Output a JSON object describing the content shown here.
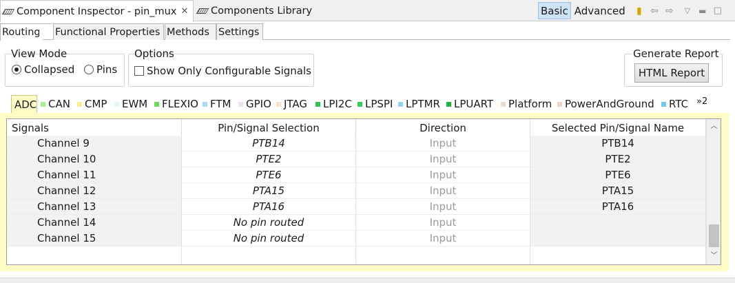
{
  "window": {
    "active_tab": "Component Inspector - pin_mux",
    "other_tab": "Components Library",
    "mode_basic": "Basic",
    "mode_advanced": "Advanced",
    "icons": [
      "note-icon",
      "back-arrow-icon",
      "forward-arrow-icon",
      "view-menu-icon",
      "minimize-icon",
      "maximize-icon"
    ]
  },
  "page_tabs": [
    "Routing",
    "Functional Properties",
    "Methods",
    "Settings"
  ],
  "view_mode": {
    "title": "View Mode",
    "options": [
      "Collapsed",
      "Pins"
    ],
    "selected": "Collapsed"
  },
  "options_group": {
    "title": "Options",
    "checkbox_label": "Show Only Configurable Signals",
    "checked": false
  },
  "report": {
    "title": "Generate Report",
    "button": "HTML Report"
  },
  "peripherals": {
    "tabs": [
      {
        "label": "ADC",
        "color": "#f3f08a"
      },
      {
        "label": "CAN",
        "color": "#a6ee8f"
      },
      {
        "label": "CMP",
        "color": "#f4f08a"
      },
      {
        "label": "EWM",
        "color": "#e3f4fb"
      },
      {
        "label": "FLEXIO",
        "color": "#6edc5a"
      },
      {
        "label": "FTM",
        "color": "#a9dcf4"
      },
      {
        "label": "GPIO",
        "color": "#f0dff4"
      },
      {
        "label": "JTAG",
        "color": "#f8e2cf"
      },
      {
        "label": "LPI2C",
        "color": "#33c24a"
      },
      {
        "label": "LPSPI",
        "color": "#30d152"
      },
      {
        "label": "LPTMR",
        "color": "#8fd5f3"
      },
      {
        "label": "LPUART",
        "color": "#1bb53a"
      },
      {
        "label": "Platform",
        "color": "#efd8cc"
      },
      {
        "label": "PowerAndGround",
        "color": "#e6d7cd"
      },
      {
        "label": "RTC",
        "color": "#6fc8ef"
      }
    ],
    "active": "ADC",
    "more_label": "»2"
  },
  "table": {
    "headers": [
      "Signals",
      "Pin/Signal Selection",
      "Direction",
      "Selected Pin/Signal Name"
    ],
    "rows": [
      {
        "signal": "Channel 9",
        "pin": "PTB14",
        "direction": "Input",
        "name": "PTB14"
      },
      {
        "signal": "Channel 10",
        "pin": "PTE2",
        "direction": "Input",
        "name": "PTE2"
      },
      {
        "signal": "Channel 11",
        "pin": "PTE6",
        "direction": "Input",
        "name": "PTE6"
      },
      {
        "signal": "Channel 12",
        "pin": "PTA15",
        "direction": "Input",
        "name": "PTA15"
      },
      {
        "signal": "Channel 13",
        "pin": "PTA16",
        "direction": "Input",
        "name": "PTA16"
      },
      {
        "signal": "Channel 14",
        "pin": "No pin routed",
        "direction": "Input",
        "name": ""
      },
      {
        "signal": "Channel 15",
        "pin": "No pin routed",
        "direction": "Input",
        "name": ""
      }
    ]
  }
}
